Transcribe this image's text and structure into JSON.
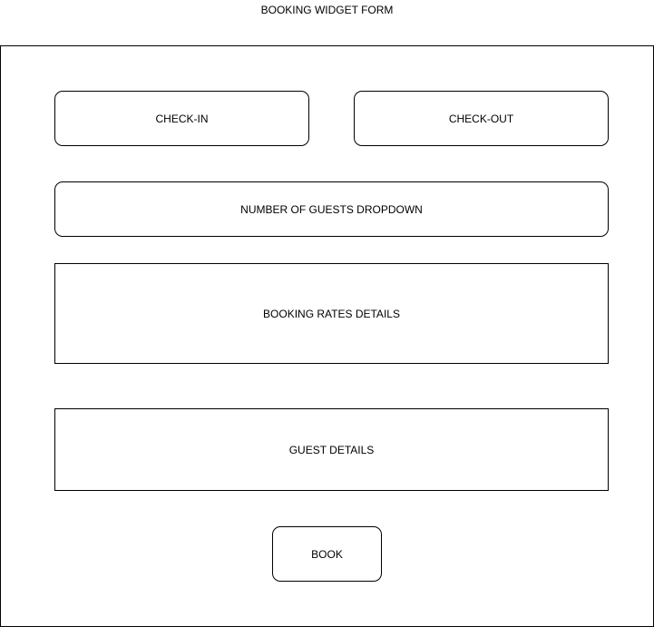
{
  "title": "BOOKING WIDGET FORM",
  "form": {
    "check_in": "CHECK-IN",
    "check_out": "CHECK-OUT",
    "guests_dropdown": "NUMBER OF GUESTS DROPDOWN",
    "rates_details": "BOOKING RATES DETAILS",
    "guest_details": "GUEST DETAILS",
    "book": "BOOK"
  }
}
